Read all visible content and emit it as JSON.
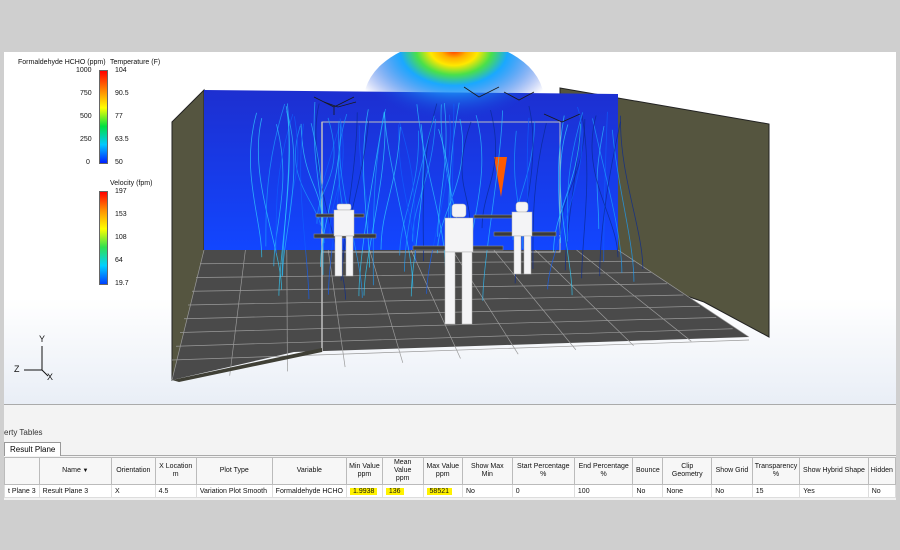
{
  "legends": {
    "formaldehyde": {
      "title": "Formaldehyde HCHO (ppm)",
      "ticks": [
        "1000",
        "750",
        "500",
        "250",
        "0"
      ]
    },
    "temperature": {
      "title": "Temperature (F)",
      "ticks": [
        "104",
        "90.5",
        "77",
        "63.5",
        "50"
      ]
    },
    "velocity": {
      "title": "Velocity (fpm)",
      "ticks": [
        "197",
        "153",
        "108",
        "64",
        "19.7"
      ]
    }
  },
  "triad": {
    "y": "Y",
    "z": "Z",
    "x": "X"
  },
  "panel": {
    "tabbar_label": "erty Tables",
    "tab_partial": "Result Plane",
    "columns": [
      {
        "l1": "",
        "l2": ""
      },
      {
        "l1": "Name",
        "l2": ""
      },
      {
        "l1": "Orientation",
        "l2": ""
      },
      {
        "l1": "X Location",
        "l2": "m"
      },
      {
        "l1": "Plot Type",
        "l2": ""
      },
      {
        "l1": "Variable",
        "l2": ""
      },
      {
        "l1": "Min Value",
        "l2": "ppm"
      },
      {
        "l1": "Mean Value",
        "l2": "ppm"
      },
      {
        "l1": "Max Value",
        "l2": "ppm"
      },
      {
        "l1": "Show Max Min",
        "l2": ""
      },
      {
        "l1": "Start Percentage",
        "l2": "%"
      },
      {
        "l1": "End Percentage",
        "l2": "%"
      },
      {
        "l1": "Bounce",
        "l2": ""
      },
      {
        "l1": "Clip Geometry",
        "l2": ""
      },
      {
        "l1": "Show Grid",
        "l2": ""
      },
      {
        "l1": "Transparency",
        "l2": "%"
      },
      {
        "l1": "Show Hybrid Shape",
        "l2": ""
      },
      {
        "l1": "Hidden",
        "l2": ""
      }
    ],
    "row": [
      "t Plane 3",
      "Result Plane 3",
      "X",
      "4.5",
      "Variation Plot Smooth",
      "Formaldehyde HCHO",
      "1.9938",
      "136",
      "58521",
      "No",
      "0",
      "100",
      "No",
      "None",
      "No",
      "15",
      "Yes",
      "No"
    ],
    "highlight_cols": [
      6,
      7,
      8
    ]
  },
  "colors": {
    "room_back": "#1533d8",
    "floor": "#4a4a4a",
    "walls": "#55553f",
    "highlight": "#fff200"
  }
}
